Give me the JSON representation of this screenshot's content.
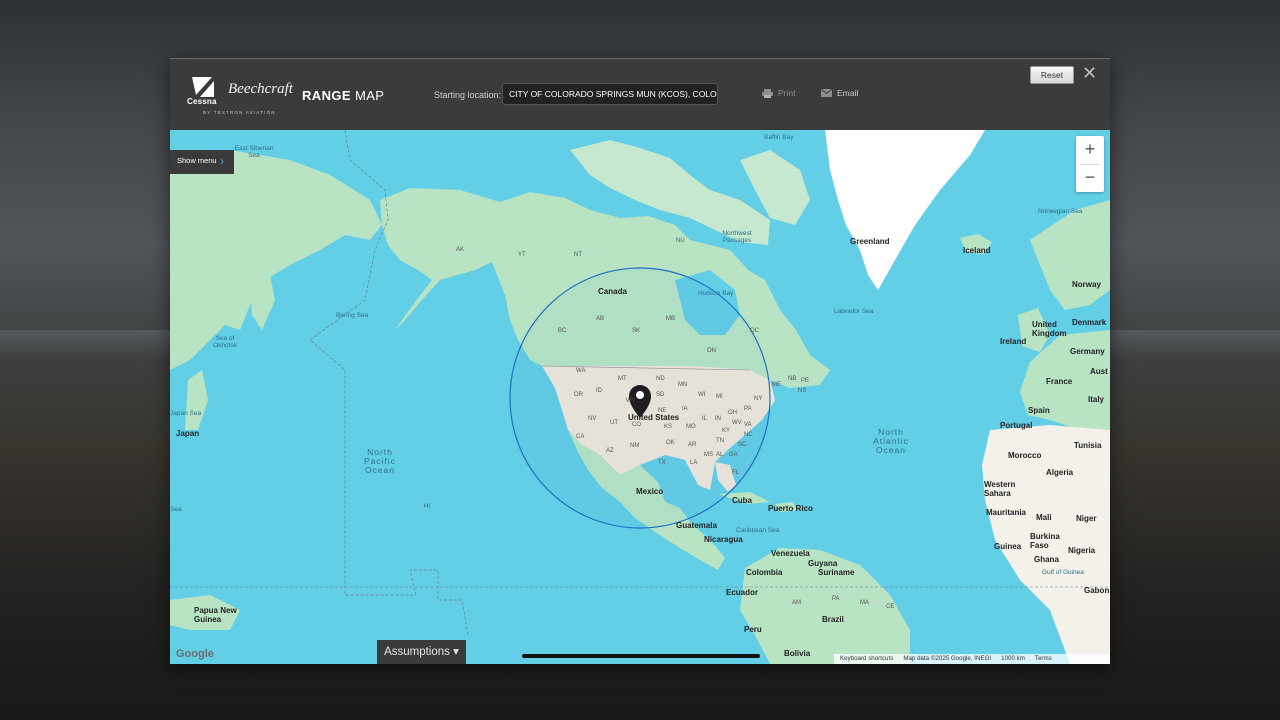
{
  "header": {
    "brand_cessna": "Cessna",
    "brand_beechcraft": "Beechcraft",
    "brand_textron": "BY TEXTRON AVIATION",
    "title_bold": "RANGE",
    "title_rest": " MAP",
    "starting_location_label": "Starting location:",
    "starting_location_value": "CITY OF COLORADO SPRINGS MUN (KCOS), COLOR",
    "print_label": "Print",
    "email_label": "Email",
    "reset_label": "Reset",
    "close_symbol": "✕"
  },
  "map": {
    "show_menu_label": "Show menu",
    "zoom_in": "+",
    "zoom_out": "−",
    "assumptions_label": "Assumptions ▾",
    "google_label": "Google",
    "footer": {
      "shortcuts": "Keyboard shortcuts",
      "attribution": "Map data ©2025 Google, INEGI",
      "scale": "1000 km",
      "terms": "Terms"
    },
    "labels": {
      "east_siberian_sea": "East Siberian Sea",
      "baffin_bay": "Baffin Bay",
      "greenland": "Greenland",
      "iceland": "Iceland",
      "norwegian_sea": "Norwegian Sea",
      "norway": "Norway",
      "canada": "Canada",
      "hudson_bay": "Hudson Bay",
      "northwest_passages": "Northwest Passages",
      "labrador_sea": "Labrador Sea",
      "bering_sea": "Bering Sea",
      "sea_of_okhotsk": "Sea of Okhotsk",
      "united_kingdom": "United Kingdom",
      "ireland": "Ireland",
      "denmark": "Denmark",
      "germany": "Germany",
      "france": "France",
      "austria": "Aust",
      "italy": "Italy",
      "spain": "Spain",
      "portugal": "Portugal",
      "tunisia": "Tunisia",
      "morocco": "Morocco",
      "algeria": "Algeria",
      "western_sahara": "Western Sahara",
      "mauritania": "Mauritania",
      "mali": "Mali",
      "niger": "Niger",
      "guinea": "Guinea",
      "burkina_faso": "Burkina Faso",
      "ghana": "Ghana",
      "nigeria": "Nigeria",
      "gulf_of_guinea": "Gulf of Guinea",
      "gabon": "Gabon",
      "japan": "Japan",
      "japan_sea": "Japan Sea",
      "sea": "Sea",
      "north_pacific_ocean": "North Pacific Ocean",
      "north_atlantic_ocean": "North Atlantic Ocean",
      "united_states": "United States",
      "mexico": "Mexico",
      "cuba": "Cuba",
      "puerto_rico": "Puerto Rico",
      "guatemala": "Guatemala",
      "caribbean_sea": "Caribbean Sea",
      "nicaragua": "Nicaragua",
      "venezuela": "Venezuela",
      "guyana": "Guyana",
      "suriname": "Suriname",
      "colombia": "Colombia",
      "ecuador": "Ecuador",
      "peru": "Peru",
      "brazil": "Brazil",
      "bolivia": "Bolivia",
      "papua_new_guinea": "Papua New Guinea",
      "hi": "HI",
      "ak": "AK",
      "yt": "YT",
      "nt": "NT",
      "nu": "NU",
      "bc": "BC",
      "ab": "AB",
      "sk": "SK",
      "mb": "MB",
      "on": "ON",
      "qc": "QC",
      "nb": "NB",
      "pe": "PE",
      "ns": "NS",
      "wa": "WA",
      "or": "OR",
      "id": "ID",
      "mt": "MT",
      "nd": "ND",
      "sd": "SD",
      "wy": "WY",
      "ne": "NE",
      "nv": "NV",
      "ut": "UT",
      "co": "CO",
      "ca": "CA",
      "az": "AZ",
      "nm": "NM",
      "tx": "TX",
      "ok": "OK",
      "ks": "KS",
      "mn": "MN",
      "ia": "IA",
      "mo": "MO",
      "ar": "AR",
      "la": "LA",
      "wi": "WI",
      "il": "IL",
      "mi": "MI",
      "in": "IN",
      "oh": "OH",
      "ky": "KY",
      "tn": "TN",
      "ms": "MS",
      "al": "AL",
      "ga": "GA",
      "fl": "FL",
      "sc": "SC",
      "nc": "NC",
      "va": "VA",
      "wv": "WV",
      "pa": "PA",
      "ny": "NY",
      "me": "ME",
      "am": "AM",
      "pa_br": "PA",
      "ma": "MA",
      "ce": "CE"
    }
  },
  "colors": {
    "water": "#63cfe7",
    "land": "#b8e4c4",
    "us_land": "#efe8db",
    "range_circle": "#1f6fc2"
  }
}
